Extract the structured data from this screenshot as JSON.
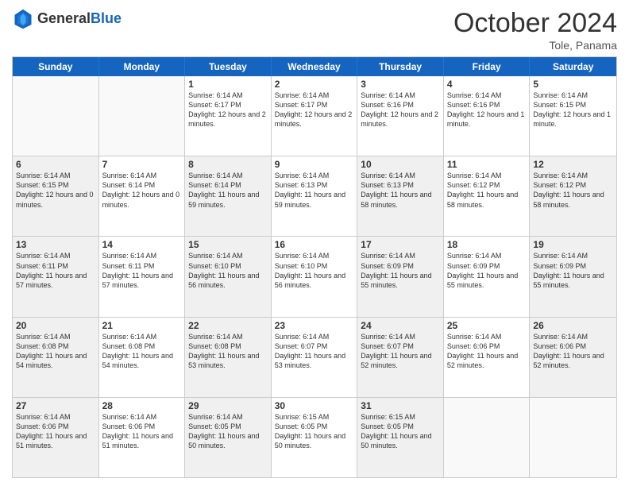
{
  "logo": {
    "general": "General",
    "blue": "Blue"
  },
  "title": "October 2024",
  "subtitle": "Tole, Panama",
  "days": [
    "Sunday",
    "Monday",
    "Tuesday",
    "Wednesday",
    "Thursday",
    "Friday",
    "Saturday"
  ],
  "weeks": [
    [
      {
        "day": "",
        "empty": true
      },
      {
        "day": "",
        "empty": true
      },
      {
        "day": "1",
        "sunrise": "Sunrise: 6:14 AM",
        "sunset": "Sunset: 6:17 PM",
        "daylight": "Daylight: 12 hours and 2 minutes."
      },
      {
        "day": "2",
        "sunrise": "Sunrise: 6:14 AM",
        "sunset": "Sunset: 6:17 PM",
        "daylight": "Daylight: 12 hours and 2 minutes."
      },
      {
        "day": "3",
        "sunrise": "Sunrise: 6:14 AM",
        "sunset": "Sunset: 6:16 PM",
        "daylight": "Daylight: 12 hours and 2 minutes."
      },
      {
        "day": "4",
        "sunrise": "Sunrise: 6:14 AM",
        "sunset": "Sunset: 6:16 PM",
        "daylight": "Daylight: 12 hours and 1 minute."
      },
      {
        "day": "5",
        "sunrise": "Sunrise: 6:14 AM",
        "sunset": "Sunset: 6:15 PM",
        "daylight": "Daylight: 12 hours and 1 minute."
      }
    ],
    [
      {
        "day": "6",
        "sunrise": "Sunrise: 6:14 AM",
        "sunset": "Sunset: 6:15 PM",
        "daylight": "Daylight: 12 hours and 0 minutes.",
        "shaded": true
      },
      {
        "day": "7",
        "sunrise": "Sunrise: 6:14 AM",
        "sunset": "Sunset: 6:14 PM",
        "daylight": "Daylight: 12 hours and 0 minutes."
      },
      {
        "day": "8",
        "sunrise": "Sunrise: 6:14 AM",
        "sunset": "Sunset: 6:14 PM",
        "daylight": "Daylight: 11 hours and 59 minutes.",
        "shaded": true
      },
      {
        "day": "9",
        "sunrise": "Sunrise: 6:14 AM",
        "sunset": "Sunset: 6:13 PM",
        "daylight": "Daylight: 11 hours and 59 minutes."
      },
      {
        "day": "10",
        "sunrise": "Sunrise: 6:14 AM",
        "sunset": "Sunset: 6:13 PM",
        "daylight": "Daylight: 11 hours and 58 minutes.",
        "shaded": true
      },
      {
        "day": "11",
        "sunrise": "Sunrise: 6:14 AM",
        "sunset": "Sunset: 6:12 PM",
        "daylight": "Daylight: 11 hours and 58 minutes."
      },
      {
        "day": "12",
        "sunrise": "Sunrise: 6:14 AM",
        "sunset": "Sunset: 6:12 PM",
        "daylight": "Daylight: 11 hours and 58 minutes.",
        "shaded": true
      }
    ],
    [
      {
        "day": "13",
        "sunrise": "Sunrise: 6:14 AM",
        "sunset": "Sunset: 6:11 PM",
        "daylight": "Daylight: 11 hours and 57 minutes.",
        "shaded": true
      },
      {
        "day": "14",
        "sunrise": "Sunrise: 6:14 AM",
        "sunset": "Sunset: 6:11 PM",
        "daylight": "Daylight: 11 hours and 57 minutes."
      },
      {
        "day": "15",
        "sunrise": "Sunrise: 6:14 AM",
        "sunset": "Sunset: 6:10 PM",
        "daylight": "Daylight: 11 hours and 56 minutes.",
        "shaded": true
      },
      {
        "day": "16",
        "sunrise": "Sunrise: 6:14 AM",
        "sunset": "Sunset: 6:10 PM",
        "daylight": "Daylight: 11 hours and 56 minutes."
      },
      {
        "day": "17",
        "sunrise": "Sunrise: 6:14 AM",
        "sunset": "Sunset: 6:09 PM",
        "daylight": "Daylight: 11 hours and 55 minutes.",
        "shaded": true
      },
      {
        "day": "18",
        "sunrise": "Sunrise: 6:14 AM",
        "sunset": "Sunset: 6:09 PM",
        "daylight": "Daylight: 11 hours and 55 minutes."
      },
      {
        "day": "19",
        "sunrise": "Sunrise: 6:14 AM",
        "sunset": "Sunset: 6:09 PM",
        "daylight": "Daylight: 11 hours and 55 minutes.",
        "shaded": true
      }
    ],
    [
      {
        "day": "20",
        "sunrise": "Sunrise: 6:14 AM",
        "sunset": "Sunset: 6:08 PM",
        "daylight": "Daylight: 11 hours and 54 minutes.",
        "shaded": true
      },
      {
        "day": "21",
        "sunrise": "Sunrise: 6:14 AM",
        "sunset": "Sunset: 6:08 PM",
        "daylight": "Daylight: 11 hours and 54 minutes."
      },
      {
        "day": "22",
        "sunrise": "Sunrise: 6:14 AM",
        "sunset": "Sunset: 6:08 PM",
        "daylight": "Daylight: 11 hours and 53 minutes.",
        "shaded": true
      },
      {
        "day": "23",
        "sunrise": "Sunrise: 6:14 AM",
        "sunset": "Sunset: 6:07 PM",
        "daylight": "Daylight: 11 hours and 53 minutes."
      },
      {
        "day": "24",
        "sunrise": "Sunrise: 6:14 AM",
        "sunset": "Sunset: 6:07 PM",
        "daylight": "Daylight: 11 hours and 52 minutes.",
        "shaded": true
      },
      {
        "day": "25",
        "sunrise": "Sunrise: 6:14 AM",
        "sunset": "Sunset: 6:06 PM",
        "daylight": "Daylight: 11 hours and 52 minutes."
      },
      {
        "day": "26",
        "sunrise": "Sunrise: 6:14 AM",
        "sunset": "Sunset: 6:06 PM",
        "daylight": "Daylight: 11 hours and 52 minutes.",
        "shaded": true
      }
    ],
    [
      {
        "day": "27",
        "sunrise": "Sunrise: 6:14 AM",
        "sunset": "Sunset: 6:06 PM",
        "daylight": "Daylight: 11 hours and 51 minutes.",
        "shaded": true
      },
      {
        "day": "28",
        "sunrise": "Sunrise: 6:14 AM",
        "sunset": "Sunset: 6:06 PM",
        "daylight": "Daylight: 11 hours and 51 minutes."
      },
      {
        "day": "29",
        "sunrise": "Sunrise: 6:14 AM",
        "sunset": "Sunset: 6:05 PM",
        "daylight": "Daylight: 11 hours and 50 minutes.",
        "shaded": true
      },
      {
        "day": "30",
        "sunrise": "Sunrise: 6:15 AM",
        "sunset": "Sunset: 6:05 PM",
        "daylight": "Daylight: 11 hours and 50 minutes."
      },
      {
        "day": "31",
        "sunrise": "Sunrise: 6:15 AM",
        "sunset": "Sunset: 6:05 PM",
        "daylight": "Daylight: 11 hours and 50 minutes.",
        "shaded": true
      },
      {
        "day": "",
        "empty": true
      },
      {
        "day": "",
        "empty": true
      }
    ]
  ]
}
